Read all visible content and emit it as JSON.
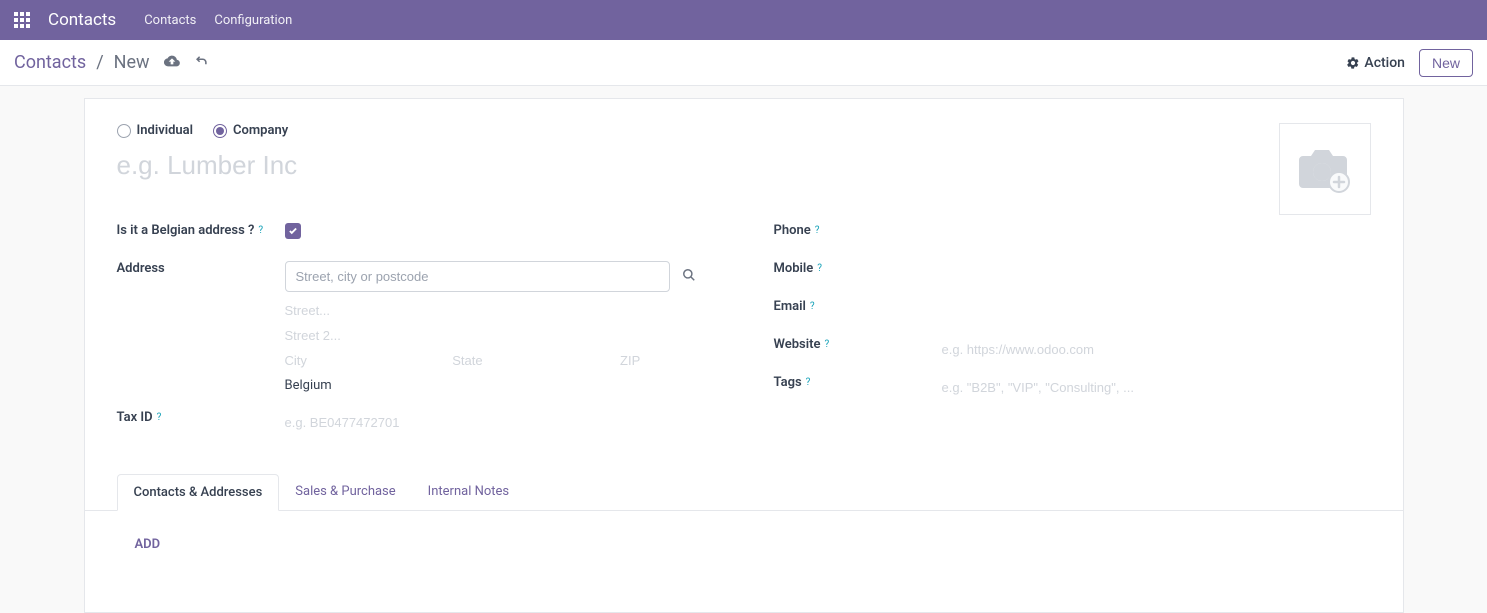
{
  "topbar": {
    "title": "Contacts",
    "links": [
      "Contacts",
      "Configuration"
    ]
  },
  "breadcrumb": {
    "root": "Contacts",
    "sep": "/",
    "current": "New"
  },
  "actions": {
    "action_label": "Action",
    "new_label": "New"
  },
  "radios": {
    "individual": "Individual",
    "company": "Company",
    "selected": "company"
  },
  "name_placeholder": "e.g. Lumber Inc",
  "left_fields": {
    "belgian_label": "Is it a Belgian address ?",
    "belgian_checked": true,
    "address_label": "Address",
    "address_search_placeholder": "Street, city or postcode",
    "street_placeholder": "Street...",
    "street2_placeholder": "Street 2...",
    "city_placeholder": "City",
    "state_placeholder": "State",
    "zip_placeholder": "ZIP",
    "country_value": "Belgium",
    "taxid_label": "Tax ID",
    "taxid_placeholder": "e.g. BE0477472701"
  },
  "right_fields": {
    "phone_label": "Phone",
    "mobile_label": "Mobile",
    "email_label": "Email",
    "website_label": "Website",
    "website_placeholder": "e.g. https://www.odoo.com",
    "tags_label": "Tags",
    "tags_placeholder": "e.g. \"B2B\", \"VIP\", \"Consulting\", ..."
  },
  "tabs": [
    "Contacts & Addresses",
    "Sales & Purchase",
    "Internal Notes"
  ],
  "tab_content": {
    "add_label": "ADD"
  }
}
